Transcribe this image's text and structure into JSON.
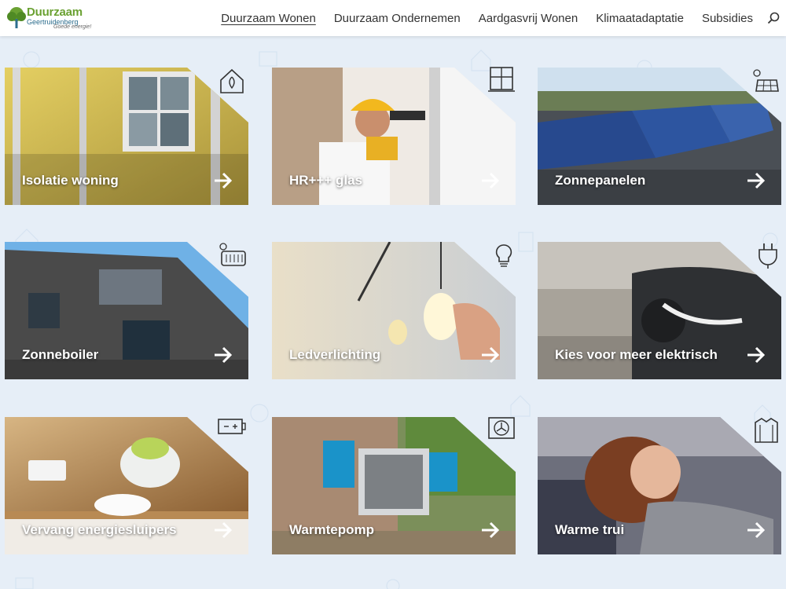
{
  "logo": {
    "title": "Duurzaam",
    "subtitle": "Geertruidenberg",
    "tagline": "Goede energie!"
  },
  "nav": {
    "items": [
      "Duurzaam Wonen",
      "Duurzaam Ondernemen",
      "Aardgasvrij Wonen",
      "Klimaatadaptatie",
      "Subsidies"
    ],
    "active": "Duurzaam Wonen"
  },
  "tiles": [
    {
      "label": "Isolatie woning",
      "icon": "house-icon"
    },
    {
      "label": "HR+++ glas",
      "icon": "window-icon"
    },
    {
      "label": "Zonnepanelen",
      "icon": "solar-panel-icon"
    },
    {
      "label": "Zonneboiler",
      "icon": "solar-boiler-icon"
    },
    {
      "label": "Ledverlichting",
      "icon": "light-bulb-icon"
    },
    {
      "label": "Kies voor meer elektrisch",
      "icon": "plug-icon"
    },
    {
      "label": "Vervang energiesluipers",
      "icon": "battery-icon"
    },
    {
      "label": "Warmtepomp",
      "icon": "heat-pump-icon"
    },
    {
      "label": "Warme trui",
      "icon": "sweater-icon"
    }
  ],
  "colors": {
    "accent_green": "#6aa132",
    "logo_blue": "#2d6e8e",
    "page_bg": "#e6eef7"
  }
}
